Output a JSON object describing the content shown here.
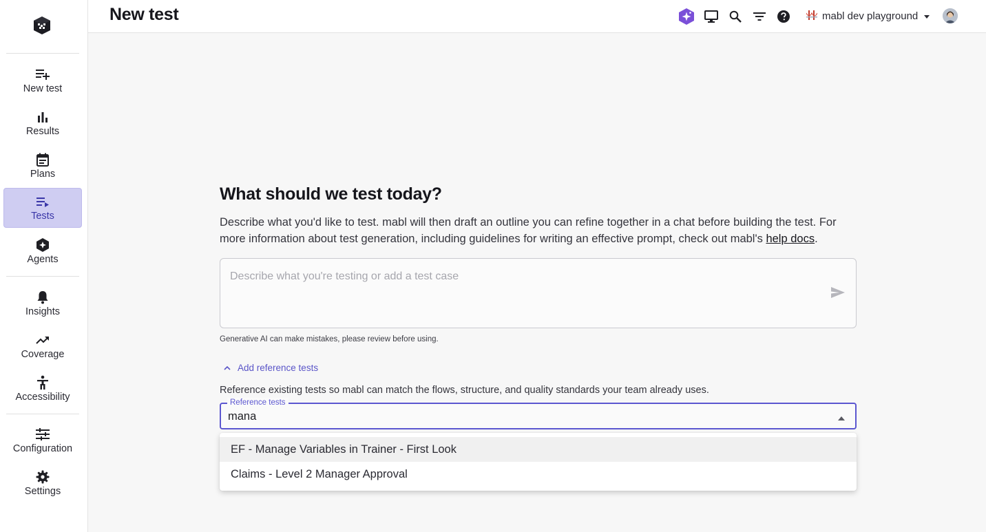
{
  "sidebar": {
    "items": [
      {
        "label": "New test",
        "icon": "playlist-add-icon"
      },
      {
        "label": "Results",
        "icon": "bar-chart-icon"
      },
      {
        "label": "Plans",
        "icon": "calendar-icon"
      },
      {
        "label": "Tests",
        "icon": "playlist-icon",
        "active": true
      },
      {
        "label": "Agents",
        "icon": "agent-sparkle-icon"
      },
      {
        "label": "Insights",
        "icon": "bell-icon"
      },
      {
        "label": "Coverage",
        "icon": "trending-up-icon"
      },
      {
        "label": "Accessibility",
        "icon": "accessibility-icon"
      },
      {
        "label": "Configuration",
        "icon": "tune-icon"
      },
      {
        "label": "Settings",
        "icon": "gear-icon"
      }
    ]
  },
  "header": {
    "title": "New test",
    "workspace": "mabl dev playground",
    "icons": [
      "ai-sparkle-icon",
      "desktop-icon",
      "search-icon",
      "filter-icon",
      "help-icon"
    ]
  },
  "main": {
    "heading": "What should we test today?",
    "description_pre": "Describe what you'd like to test. mabl will then draft an outline you can refine together in a chat before building the test. For more information about test generation, including guidelines for writing an effective prompt, check out mabl's ",
    "help_link": "help docs",
    "description_post": ".",
    "prompt_placeholder": "Describe what you're testing or add a test case",
    "disclaimer": "Generative AI can make mistakes, please review before using.",
    "add_reference_label": "Add reference tests",
    "reference_description": "Reference existing tests so mabl can match the flows, structure, and quality standards your team already uses.",
    "reference_field_label": "Reference tests",
    "reference_value": "mana",
    "options": [
      "EF - Manage Variables in Trainer - First Look",
      "Claims - Level 2 Manager Approval"
    ]
  },
  "colors": {
    "accent": "#5b56d0",
    "active_nav_bg": "#cfcdf2",
    "ai_badge": "#7a4fd8"
  }
}
